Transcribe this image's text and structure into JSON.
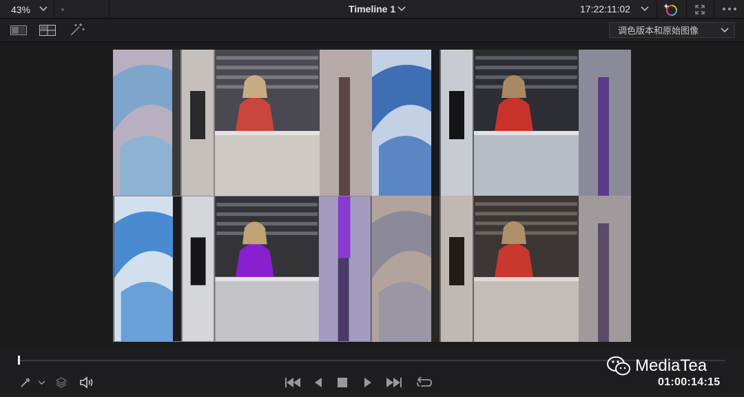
{
  "topbar": {
    "zoom": "43%",
    "timeline_title": "Timeline 1",
    "timecode": "17:22:11:02"
  },
  "toolbar": {
    "compare_mode": "调色版本和原始图像"
  },
  "transport": {
    "timecode": "01:00:14:15"
  },
  "watermark": {
    "text": "MediaTea"
  },
  "icons": {
    "single-view": "single-view-icon",
    "split-view": "split-view-icon",
    "magic-wand": "magic-wand-icon",
    "color-wheel": "color-wheel-icon",
    "fullscreen": "fullscreen-icon",
    "more": "more-icon",
    "eyedropper": "eyedropper-icon",
    "layers": "layers-icon",
    "speaker": "speaker-icon",
    "skip-back": "skip-back-icon",
    "step-back": "step-back-icon",
    "stop": "stop-icon",
    "play": "play-icon",
    "skip-forward": "skip-forward-icon",
    "loop": "loop-icon"
  },
  "colors": {
    "accent": "#e24c3c",
    "jacket_red": "#c8322a",
    "jacket_purple": "#8a1fd0"
  }
}
